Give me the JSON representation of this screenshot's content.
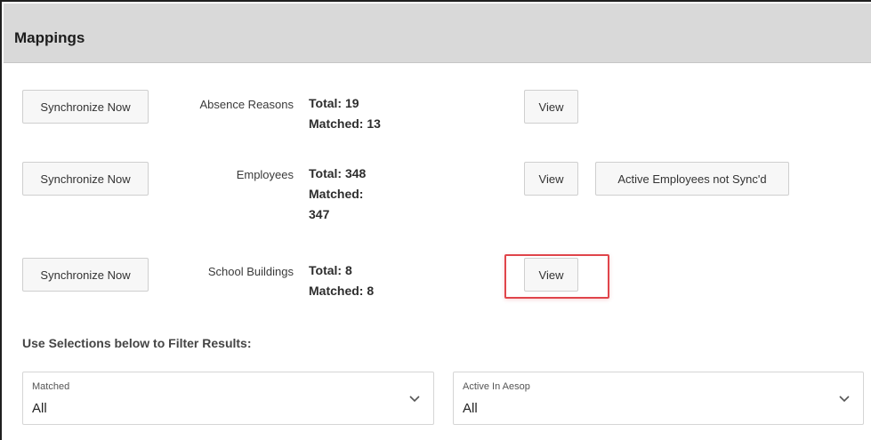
{
  "panel": {
    "title": "Mappings"
  },
  "mappings": [
    {
      "sync_label": "Synchronize Now",
      "name": "Absence Reasons",
      "total": "Total: 19",
      "matched": "Matched: 13",
      "view_label": "View"
    },
    {
      "sync_label": "Synchronize Now",
      "name": "Employees",
      "total": "Total: 348",
      "matched_line1": "Matched:",
      "matched_line2": "347",
      "view_label": "View",
      "extra_label": "Active Employees not Sync'd"
    },
    {
      "sync_label": "Synchronize Now",
      "name": "School Buildings",
      "total": "Total: 8",
      "matched": "Matched: 8",
      "view_label": "View"
    }
  ],
  "filters": {
    "heading": "Use Selections below to Filter Results:",
    "matched": {
      "label": "Matched",
      "value": "All"
    },
    "active": {
      "label": "Active In Aesop",
      "value": "All"
    }
  },
  "colors": {
    "header_bg": "#d9d9d9",
    "highlight": "#e0454b",
    "button_bg": "#f7f7f7"
  },
  "icons": {
    "dropdown": "chevron-down-icon"
  }
}
